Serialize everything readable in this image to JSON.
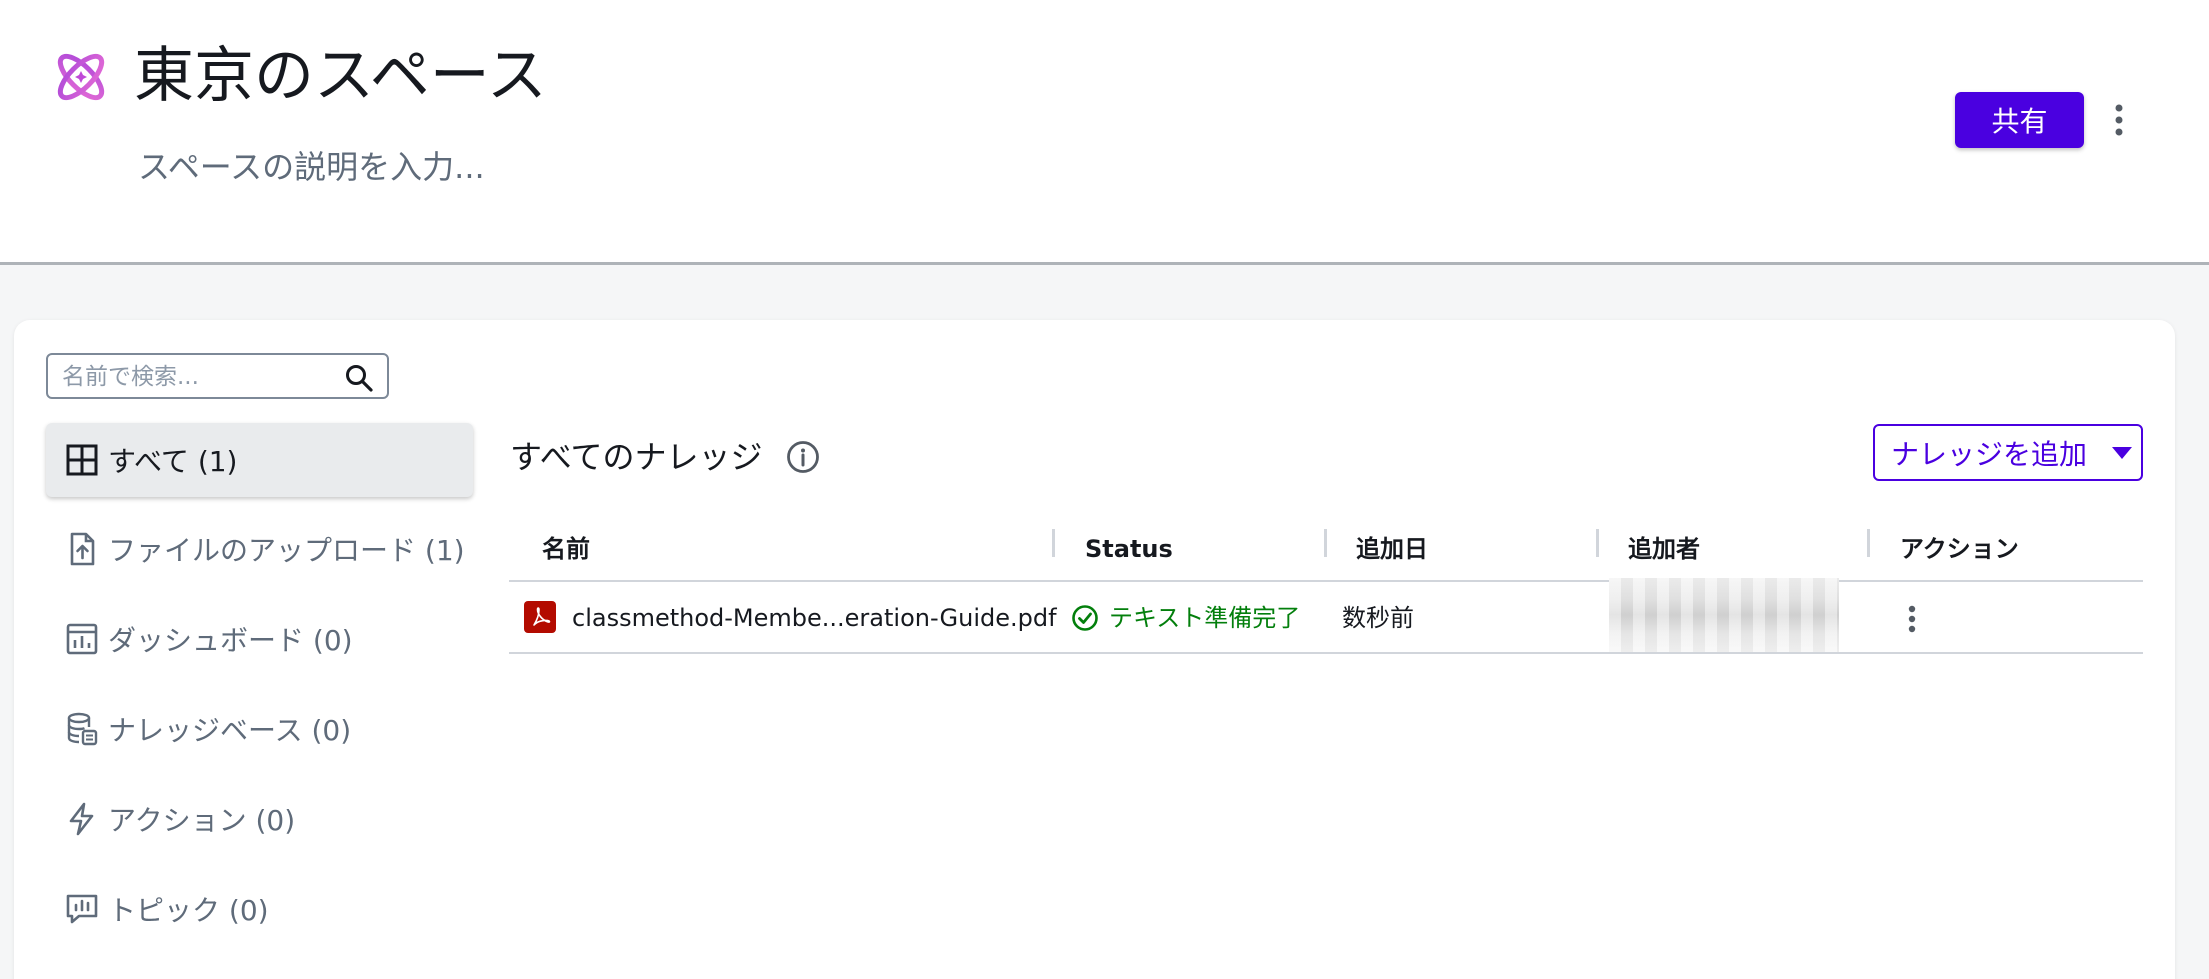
{
  "header": {
    "title": "東京のスペース",
    "description": "スペースの説明を入力...",
    "share_label": "共有",
    "logo_icon": "atom-icon",
    "accent_color": "#4a00e0"
  },
  "search": {
    "placeholder": "名前で検索..."
  },
  "sidebar": {
    "items": [
      {
        "label": "すべて (1)",
        "icon": "grid-icon",
        "active": true
      },
      {
        "label": "ファイルのアップロード (1)",
        "icon": "file-upload-icon"
      },
      {
        "label": "ダッシュボード (0)",
        "icon": "dashboard-icon"
      },
      {
        "label": "ナレッジベース (0)",
        "icon": "database-icon"
      },
      {
        "label": "アクション (0)",
        "icon": "lightning-icon"
      },
      {
        "label": "トピック (0)",
        "icon": "topic-icon"
      }
    ]
  },
  "main": {
    "section_title": "すべてのナレッジ",
    "add_label": "ナレッジを追加",
    "table": {
      "columns": [
        "名前",
        "Status",
        "追加日",
        "追加者",
        "アクション"
      ],
      "rows": [
        {
          "name": "classmethod-Membe...eration-Guide.pdf",
          "status": "テキスト準備完了",
          "added": "数秒前",
          "added_by": ""
        }
      ]
    }
  }
}
